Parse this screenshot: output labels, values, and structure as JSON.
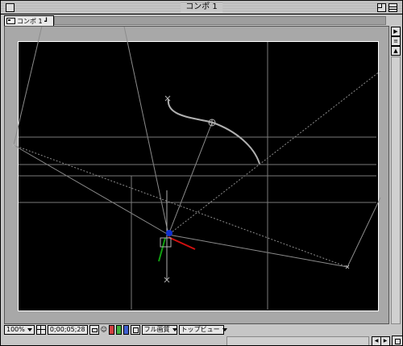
{
  "window": {
    "title": "コンポ 1"
  },
  "tab": {
    "label": "コンポ 1 ┛"
  },
  "footer": {
    "zoom": "100%",
    "timecode": "0;00;05;28",
    "resolution": "フル画質",
    "view": "トップビュー"
  },
  "colors": {
    "canvas": "#000000",
    "guide_lines": "#8c8c8c",
    "motion_path": "#b0b0b0",
    "axis_x": "#d01010",
    "axis_y": "#10a010",
    "axis_z": "#1030d0",
    "swatch_red": "#d04040",
    "swatch_green": "#40b040",
    "swatch_blue": "#4060d0"
  },
  "icons": [
    "close-box",
    "zoom-box",
    "collapse-box",
    "composition-icon",
    "grid-icon",
    "camera-icon",
    "person-icon",
    "rgb-channel-icon",
    "region-of-interest-icon",
    "scroll-arrow-icon"
  ]
}
